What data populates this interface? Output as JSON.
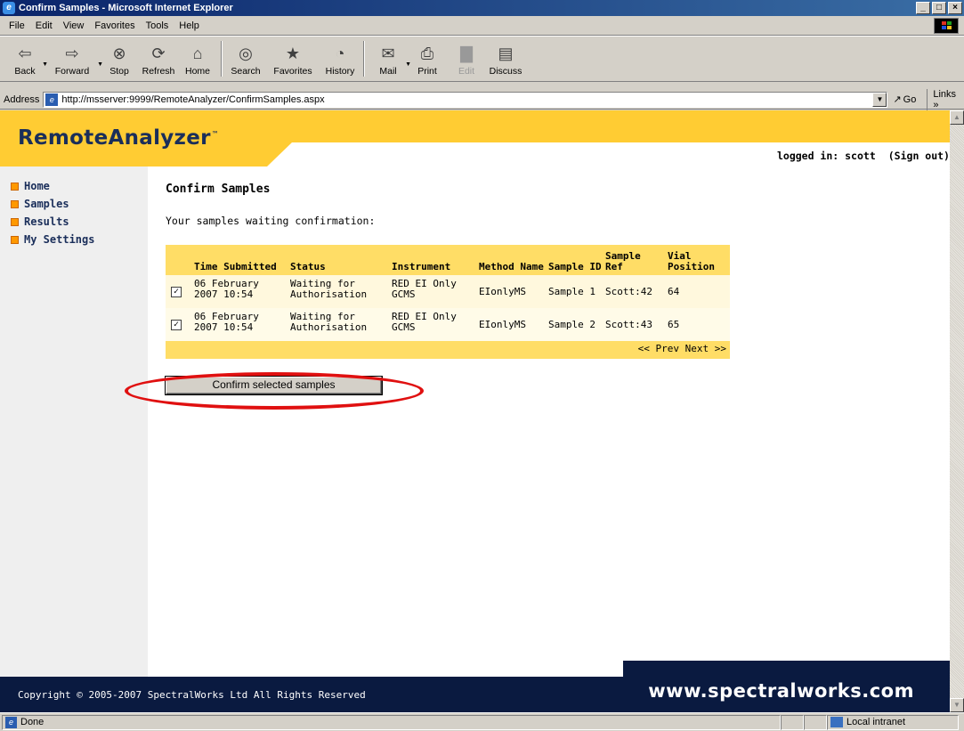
{
  "window": {
    "title": "Confirm Samples - Microsoft Internet Explorer",
    "controls": [
      "_",
      "□",
      "×"
    ]
  },
  "menubar": {
    "items": [
      "File",
      "Edit",
      "View",
      "Favorites",
      "Tools",
      "Help"
    ]
  },
  "toolbar": {
    "buttons": [
      {
        "label": "Back",
        "icon": "back-arrow-icon",
        "glyph": "⇦"
      },
      {
        "label": "Forward",
        "icon": "forward-arrow-icon",
        "glyph": "⇨"
      },
      {
        "label": "Stop",
        "icon": "stop-icon",
        "glyph": "⊗"
      },
      {
        "label": "Refresh",
        "icon": "refresh-icon",
        "glyph": "⟳"
      },
      {
        "label": "Home",
        "icon": "home-icon",
        "glyph": "⌂"
      },
      {
        "label": "Search",
        "icon": "search-icon",
        "glyph": "◎"
      },
      {
        "label": "Favorites",
        "icon": "favorites-icon",
        "glyph": "★"
      },
      {
        "label": "History",
        "icon": "history-icon",
        "glyph": "◔"
      },
      {
        "label": "Mail",
        "icon": "mail-icon",
        "glyph": "✉"
      },
      {
        "label": "Print",
        "icon": "print-icon",
        "glyph": "⎙"
      },
      {
        "label": "Edit",
        "icon": "edit-icon",
        "glyph": "▇"
      },
      {
        "label": "Discuss",
        "icon": "discuss-icon",
        "glyph": "▤"
      }
    ]
  },
  "addressbar": {
    "label": "Address",
    "url": "http://msserver:9999/RemoteAnalyzer/ConfirmSamples.aspx",
    "go_label": "Go",
    "links_label": "Links »"
  },
  "header": {
    "logo": "RemoteAnalyzer",
    "logo_tm": "™",
    "logged_in": "logged in: scott",
    "sign_out": "(Sign out)"
  },
  "sidebar": {
    "items": [
      {
        "label": "Home"
      },
      {
        "label": "Samples"
      },
      {
        "label": "Results"
      },
      {
        "label": "My Settings"
      }
    ]
  },
  "main": {
    "title": "Confirm Samples",
    "subtitle": "Your samples waiting confirmation:",
    "table": {
      "columns": [
        "",
        "Time Submitted",
        "Status",
        "Instrument",
        "Method Name",
        "Sample ID",
        "Sample Ref",
        "Vial Position"
      ],
      "rows": [
        {
          "checked": true,
          "time": "06 February 2007 10:54",
          "status": "Waiting for Authorisation",
          "instrument": "RED EI Only GCMS",
          "method": "EIonlyMS",
          "sample_id": "Sample 1",
          "sample_ref": "Scott:42",
          "vial": "64"
        },
        {
          "checked": true,
          "time": "06 February 2007 10:54",
          "status": "Waiting for Authorisation",
          "instrument": "RED EI Only GCMS",
          "method": "EIonlyMS",
          "sample_id": "Sample 2",
          "sample_ref": "Scott:43",
          "vial": "65"
        }
      ],
      "pager": "<< Prev Next >>"
    },
    "confirm_button": "Confirm selected samples"
  },
  "footer": {
    "copyright": "Copyright © 2005-2007 SpectralWorks Ltd  All Rights Reserved",
    "url": "www.spectralworks.com"
  },
  "statusbar": {
    "status": "Done",
    "zone": "Local intranet"
  },
  "colors": {
    "banner_yellow": "#ffcc33",
    "table_header": "#ffdd66",
    "footer_navy": "#0a1a40",
    "highlight_red": "#e01010"
  }
}
